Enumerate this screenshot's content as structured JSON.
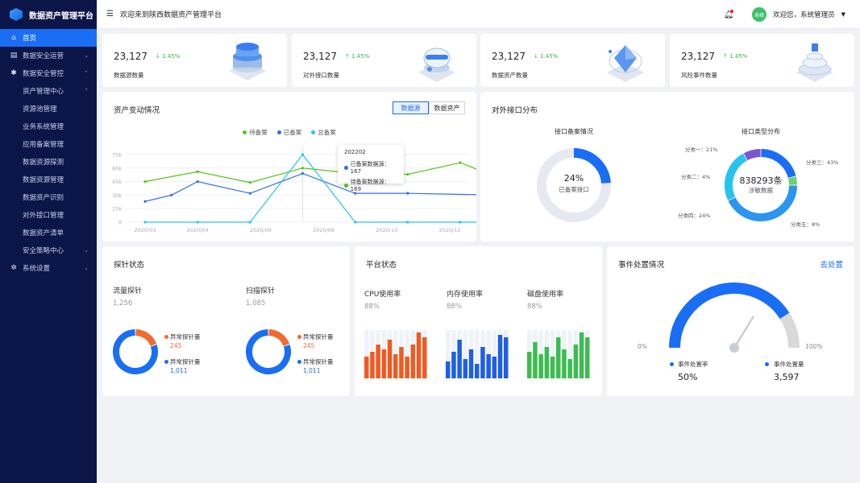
{
  "app": {
    "title": "数据资产管理平台"
  },
  "sidebar": {
    "items": [
      {
        "label": "首页",
        "icon": "home-icon"
      },
      {
        "label": "数据安全运营",
        "icon": "dashboard-icon"
      },
      {
        "label": "数据安全管控",
        "icon": "gear-icon"
      },
      {
        "label": "资产管理中心"
      },
      {
        "label": "资源池管理"
      },
      {
        "label": "业务系统管理"
      },
      {
        "label": "应用备案管理"
      },
      {
        "label": "数据资源探测"
      },
      {
        "label": "数据资源管理"
      },
      {
        "label": "数据资产识别"
      },
      {
        "label": "对外接口管理"
      },
      {
        "label": "数据资产清单"
      },
      {
        "label": "安全策略中心"
      },
      {
        "label": "系统设置",
        "icon": "settings-icon"
      }
    ]
  },
  "header": {
    "welcome": "欢迎来到陕西数据资产管理平台",
    "avatar_text": "系统",
    "user": "欢迎您，系统管理员"
  },
  "stats": [
    {
      "value": "23,127",
      "change": "1.45%",
      "label": "数据源数量"
    },
    {
      "value": "23,127",
      "change": "1.45%",
      "label": "对外接口数量"
    },
    {
      "value": "23,127",
      "change": "1.45%",
      "label": "数据资产数量"
    },
    {
      "value": "23,127",
      "change": "1.45%",
      "label": "风险事件数量"
    }
  ],
  "asset_change": {
    "title": "资产变动情况",
    "toggle": [
      "数据源",
      "数据资产"
    ],
    "legend": [
      "待备案",
      "已备案",
      "总备案"
    ],
    "tooltip": {
      "title": "202202",
      "row1": "已备案数据源：167",
      "row2": "待备案数据源：169"
    }
  },
  "interface": {
    "title": "对外接口分布",
    "left_title": "接口备案情况",
    "left_pct": "24%",
    "left_label": "已备案接口",
    "right_title": "接口类型分布",
    "right_value": "838293条",
    "right_label": "涉敏数据",
    "slices": [
      "分类一：21%",
      "分类二：4%",
      "分类三：43%",
      "分类四：24%",
      "分类五：8%"
    ]
  },
  "probe": {
    "title": "探针状态",
    "flow_name": "流量探针",
    "flow_num": "1,256",
    "scan_name": "扫描探针",
    "scan_num": "1,085",
    "abnormal_label": "异常探针量",
    "flow_abnormal": "245",
    "flow_normal": "1,011",
    "scan_abnormal": "245",
    "scan_normal": "1,011"
  },
  "platform": {
    "title": "平台状态",
    "cpu_label": "CPU使用率",
    "cpu_value": "88%",
    "mem_label": "内存使用率",
    "mem_value": "88%",
    "disk_label": "磁盘使用率",
    "disk_value": "88%"
  },
  "event": {
    "title": "事件处置情况",
    "link": "去处置",
    "min": "0%",
    "max": "100%",
    "rate_label": "事件处置率",
    "rate_value": "50%",
    "count_label": "事件处置量",
    "count_value": "3,597"
  },
  "chart_data": [
    {
      "type": "line",
      "title": "资产变动情况",
      "categories": [
        "2020/03",
        "2020/04",
        "2020/06",
        "2020/08",
        "2020/10",
        "2020/12"
      ],
      "y_ticks": [
        "0",
        "15k",
        "30k",
        "45k",
        "60k",
        "75k"
      ],
      "ylim": [
        0,
        75000
      ],
      "legend_position": "top-center",
      "series": [
        {
          "name": "待备案",
          "color": "#52c41a",
          "x": [
            0,
            1,
            2,
            3,
            4,
            5,
            6,
            6.7
          ],
          "values": [
            45000,
            56000,
            44000,
            60000,
            54000,
            53000,
            66000,
            50000
          ]
        },
        {
          "name": "已备案",
          "color": "#2f6fe8",
          "x": [
            0,
            0.5,
            1,
            2,
            3,
            4,
            5,
            6.7
          ],
          "values": [
            23000,
            30000,
            45000,
            32000,
            54000,
            32000,
            32000,
            30000
          ]
        },
        {
          "name": "总备案",
          "color": "#25c3f0",
          "x": [
            0,
            1,
            2,
            3,
            4,
            5,
            6,
            6.7
          ],
          "values": [
            0,
            0,
            0,
            77000,
            0,
            0,
            0,
            0
          ]
        }
      ]
    },
    {
      "type": "pie",
      "title": "接口备案情况",
      "values": [
        24,
        76
      ],
      "colors": [
        "#1a6ef5",
        "#e6e9f0"
      ]
    },
    {
      "type": "pie",
      "title": "接口类型分布",
      "categories": [
        "分类一",
        "分类二",
        "分类三",
        "分类四",
        "分类五"
      ],
      "values": [
        21,
        4,
        43,
        24,
        8
      ],
      "colors": [
        "#1a6ef5",
        "#6ad36a",
        "#2b95f0",
        "#25c3f0",
        "#7a57d1"
      ]
    },
    {
      "type": "pie",
      "title": "流量探针",
      "categories": [
        "异常探针量",
        "正常"
      ],
      "values": [
        245,
        1011
      ],
      "colors": [
        "#f26a2e",
        "#1a6ef5"
      ]
    },
    {
      "type": "pie",
      "title": "扫描探针",
      "categories": [
        "异常探针量",
        "正常"
      ],
      "values": [
        245,
        1011
      ],
      "colors": [
        "#f26a2e",
        "#1a6ef5"
      ]
    },
    {
      "type": "bar",
      "title": "CPU使用率",
      "color": "#f05a22",
      "values": [
        0.45,
        0.55,
        0.7,
        0.6,
        0.8,
        0.5,
        0.65,
        0.45,
        0.7,
        0.95,
        0.85
      ]
    },
    {
      "type": "bar",
      "title": "内存使用率",
      "color": "#1f5fe6",
      "values": [
        0.35,
        0.55,
        0.8,
        0.4,
        0.6,
        0.3,
        0.65,
        0.5,
        0.45,
        0.9,
        0.85
      ]
    },
    {
      "type": "bar",
      "title": "磁盘使用率",
      "color": "#3cbd4f",
      "values": [
        0.55,
        0.75,
        0.5,
        0.65,
        0.45,
        0.85,
        0.6,
        0.4,
        0.7,
        0.95,
        0.85
      ]
    },
    {
      "type": "gauge",
      "title": "事件处置情况",
      "value": 50,
      "min": 0,
      "max": 100
    }
  ]
}
